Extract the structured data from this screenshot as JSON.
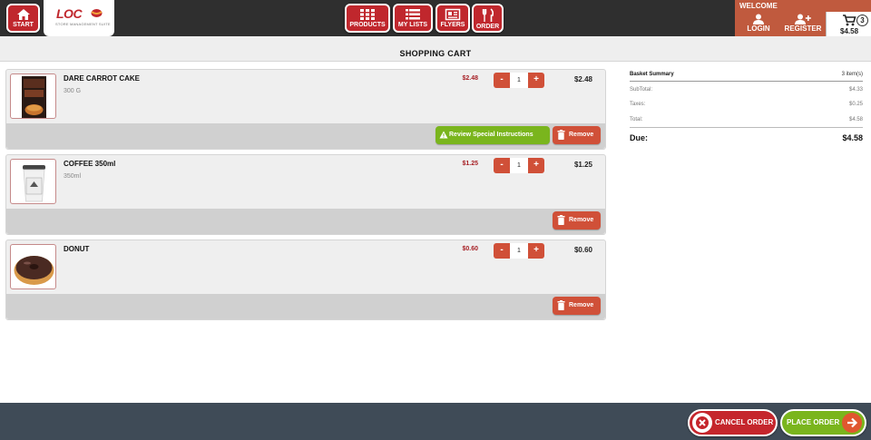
{
  "header": {
    "start_label": "START",
    "logo_text": "LOC",
    "logo_subtitle": "STORE MANAGEMENT SUITE",
    "nav": [
      {
        "label": "PRODUCTS",
        "icon": "grid-icon"
      },
      {
        "label": "MY LISTS",
        "icon": "list-icon"
      },
      {
        "label": "FLYERS",
        "icon": "newspaper-icon"
      },
      {
        "label": "ORDER",
        "icon": "cutlery-icon"
      }
    ],
    "welcome_label": "WELCOME",
    "login_label": "LOGIN",
    "register_label": "REGISTER",
    "cart_count": "3",
    "cart_total": "$4.58"
  },
  "page_title": "SHOPPING CART",
  "items": [
    {
      "name": "DARE CARROT CAKE",
      "desc": "300 G",
      "unit_price": "$2.48",
      "qty": "1",
      "total": "$2.48",
      "thumb": "carrot-cake",
      "special_instructions_label": "Review Special Instructions",
      "remove_label": "Remove"
    },
    {
      "name": "COFFEE 350ml",
      "desc": "350ml",
      "unit_price": "$1.25",
      "qty": "1",
      "total": "$1.25",
      "thumb": "coffee-cup",
      "remove_label": "Remove"
    },
    {
      "name": "DONUT",
      "desc": "",
      "unit_price": "$0.60",
      "qty": "1",
      "total": "$0.60",
      "thumb": "donut",
      "remove_label": "Remove"
    }
  ],
  "qty_minus": "-",
  "qty_plus": "+",
  "summary": {
    "title": "Basket Summary",
    "count": "3 item(s)",
    "subtotal_label": "SubTotal:",
    "subtotal": "$4.33",
    "taxes_label": "Taxes:",
    "taxes": "$0.25",
    "total_label": "Total:",
    "total": "$4.58",
    "due_label": "Due:",
    "due": "$4.58"
  },
  "footer": {
    "cancel_label": "CANCEL ORDER",
    "place_label": "PLACE ORDER"
  },
  "colors": {
    "brand_red": "#c0272d",
    "action_orange": "#d05038",
    "confirm_green": "#7ab51d",
    "bottom_bar": "#3f4b57"
  }
}
